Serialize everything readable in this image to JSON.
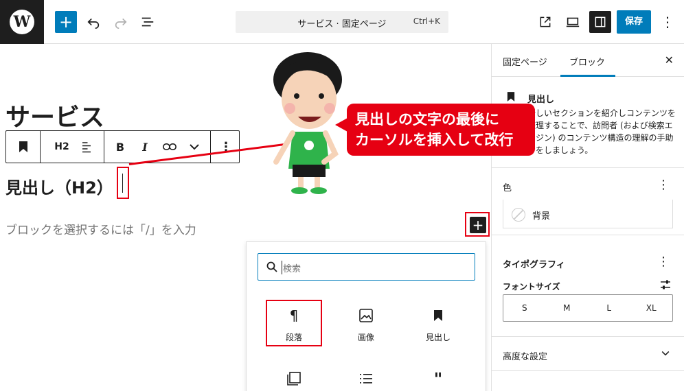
{
  "topbar": {
    "logo_letter": "W",
    "add_symbol": "+",
    "doc_title": "サービス · 固定ページ",
    "shortcut": "Ctrl+K",
    "save_label": "保存",
    "more_symbol": "⋮"
  },
  "editor": {
    "page_title": "サービス",
    "toolbar": {
      "heading_level": "H2",
      "bold": "B",
      "italic": "I",
      "more": "⋮"
    },
    "heading_text": "見出し（H2）",
    "placeholder": "ブロックを選択するには「/」を入力",
    "inline_add": "+"
  },
  "inserter": {
    "search_placeholder": "検索",
    "blocks": [
      {
        "label": "段落",
        "icon": "paragraph-icon"
      },
      {
        "label": "画像",
        "icon": "image-icon"
      },
      {
        "label": "見出し",
        "icon": "bookmark-icon"
      }
    ]
  },
  "sidebar": {
    "tabs": [
      "固定ページ",
      "ブロック"
    ],
    "close": "✕",
    "block_name": "見出し",
    "block_desc": "新しいセクションを紹介しコンテンツを整理することで、訪問者 (および検索エンジン) のコンテンツ構造の理解の手助けをしましょう。",
    "color": {
      "title": "色",
      "background_label": "背景"
    },
    "typography": {
      "title": "タイポグラフィ",
      "font_size_label": "フォントサイズ",
      "sizes": [
        "S",
        "M",
        "L",
        "XL"
      ]
    },
    "advanced": {
      "title": "高度な設定"
    }
  },
  "annotation": {
    "line1": "見出しの文字の最後に",
    "line2": "カーソルを挿入して改行",
    "accent": "#e60012"
  }
}
